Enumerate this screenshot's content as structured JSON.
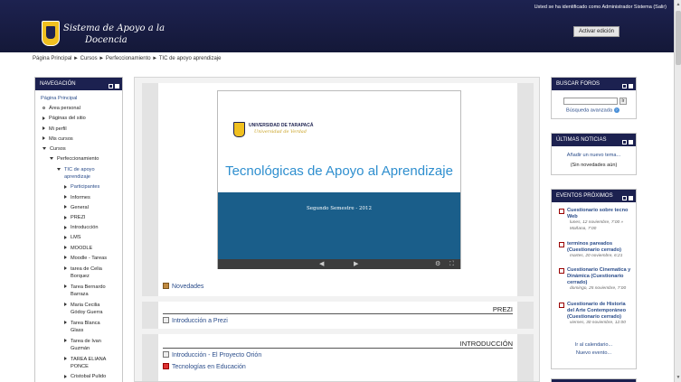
{
  "header": {
    "login_info": "Usted se ha identificado como Administrador Sistema (Salir)",
    "site_title_line1": "Sistema de Apoyo a la",
    "site_title_line2": "Docencia",
    "edit_button": "Activar edición"
  },
  "breadcrumb": "Página Principal ► Cursos ► Perfeccionamiento ► TIC de apoyo aprendizaje",
  "navigation": {
    "title": "NAVEGACIÓN",
    "items": [
      {
        "label": "Página Principal"
      },
      {
        "label": "Área personal"
      },
      {
        "label": "Páginas del sitio"
      },
      {
        "label": "Mi perfil"
      },
      {
        "label": "Mis cursos"
      },
      {
        "label": "Cursos"
      },
      {
        "label": "Perfeccionamiento"
      },
      {
        "label": "TIC de apoyo aprendizaje"
      },
      {
        "label": "Participantes"
      },
      {
        "label": "Informes"
      },
      {
        "label": "General"
      },
      {
        "label": "PREZI"
      },
      {
        "label": "Introducción"
      },
      {
        "label": "LMS"
      },
      {
        "label": "MOODLE"
      },
      {
        "label": "Moodle - Tareas"
      },
      {
        "label": "tarea de Celia Borquez"
      },
      {
        "label": "Tarea Bernardo Barraza"
      },
      {
        "label": "Maria Cecilia Gódoy Guerra"
      },
      {
        "label": "Tarea Blanca Glass"
      },
      {
        "label": "Tarea de Ivan Guzmán"
      },
      {
        "label": "TAREA ELIANA PONCE"
      },
      {
        "label": "Cristobal Pulido"
      }
    ]
  },
  "main": {
    "slide": {
      "university": "UNIVERSIDAD DE TARAPACÁ",
      "motto": "Universidad de Verdad",
      "title": "Tecnológicas de Apoyo al Aprendizaje",
      "semester": "Segundo Semestre - 2012"
    },
    "section0_link": "Novedades",
    "section1": {
      "title": "PREZI",
      "link": "Introducción a Prezi"
    },
    "section2": {
      "title": "INTRODUCCIÓN",
      "links": [
        "Introducción - El Proyecto Orión",
        "Tecnologías en Educación"
      ]
    }
  },
  "search_forums": {
    "title": "BUSCAR FOROS",
    "go": "Ir",
    "advanced": "Búsqueda avanzada"
  },
  "latest_news": {
    "title": "ÚLTIMAS NOTICIAS",
    "add": "Añadir un nuevo tema...",
    "none": "(Sin novedades aún)"
  },
  "upcoming_events": {
    "title": "EVENTOS PRÓXIMOS",
    "events": [
      {
        "name": "Cuestionario sobre tecno Web",
        "date": "lunes, 12 noviembre, 7:00 » Mañana, 7:00"
      },
      {
        "name": "terminos pareados (Cuestionario cerrado)",
        "date": "martes, 20 noviembre, 6:21"
      },
      {
        "name": "Cuestionario Cinematica y Dinámica (Cuestionario cerrado)",
        "date": "domingo, 25 noviembre, 7:00"
      },
      {
        "name": "Cuestionario de Historia del Arte Contemporáneo (Cuestionario cerrado)",
        "date": "viernes, 30 noviembre, 12:00"
      }
    ],
    "calendar": "Ir al calendario...",
    "new_event": "Nuevo evento..."
  },
  "colors": {
    "header": "#1d2250",
    "link": "#2a4c8a",
    "slide_title": "#2f8fcf",
    "slide_band": "#1a5e8a"
  }
}
